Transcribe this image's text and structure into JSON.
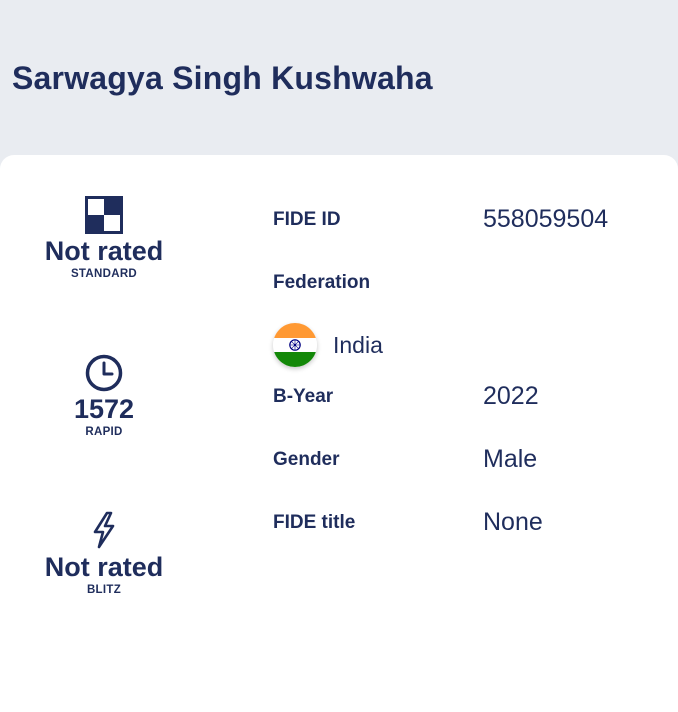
{
  "player": {
    "name": "Sarwagya Singh Kushwaha"
  },
  "ratings": {
    "standard": {
      "value": "Not rated",
      "caption": "STANDARD",
      "icon": "chessboard-icon"
    },
    "rapid": {
      "value": "1572",
      "caption": "RAPID",
      "icon": "clock-icon"
    },
    "blitz": {
      "value": "Not rated",
      "caption": "BLITZ",
      "icon": "lightning-icon"
    }
  },
  "info": {
    "fide_id_label": "FIDE ID",
    "fide_id_value": "558059504",
    "federation_label": "Federation",
    "federation_value": "India",
    "federation_flag": "india-flag-icon",
    "byear_label": "B-Year",
    "byear_value": "2022",
    "gender_label": "Gender",
    "gender_value": "Male",
    "title_label": "FIDE title",
    "title_value": "None"
  },
  "colors": {
    "text": "#1f2d5c",
    "header_bg": "#e9ecf1",
    "card_bg": "#ffffff",
    "saffron": "#ff9933",
    "green": "#138808",
    "chakra": "#000080"
  }
}
